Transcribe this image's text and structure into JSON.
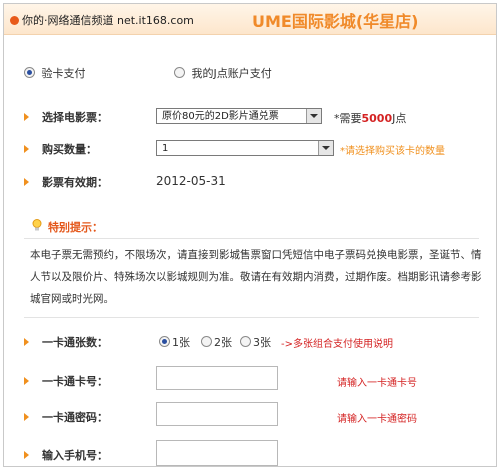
{
  "header": {
    "watermark_text": "你的·网络通信频道 net.it168.com",
    "title": "UME国际影城",
    "title_suffix": "(华星店)"
  },
  "payment": {
    "option1": "验卡支付",
    "option2": "我的J点账户支付",
    "selected": 1
  },
  "form": {
    "movie_label": "选择电影票：",
    "movie_value": "原价80元的2D影片通兑票",
    "movie_note_prefix": "*需要",
    "movie_note_amount": "5000",
    "movie_note_suffix": "J点",
    "qty_label": "购买数量：",
    "qty_value": "1",
    "qty_note": "*请选择购买该卡的数量",
    "valid_label": "影票有效期：",
    "valid_value": "2012-05-31"
  },
  "tips": {
    "heading": "特别提示：",
    "body": "本电子票无需预约，不限场次，请直接到影城售票窗口凭短信中电子票码兑换电影票，圣诞节、情人节以及限价片、特殊场次以影城规则为准。敬请在有效期内消费，过期作废。档期影讯请参考影城官网或时光网。"
  },
  "card": {
    "count_label": "一卡通张数：",
    "count_options": [
      "1张",
      "2张",
      "3张"
    ],
    "count_selected": 0,
    "count_link": "->多张组合支付使用说明",
    "number_label": "一卡通卡号：",
    "number_hint": "请输入一卡通卡号",
    "password_label": "一卡通密码：",
    "password_hint": "请输入一卡通密码",
    "phone_label": "输入手机号："
  },
  "colors": {
    "accent_orange": "#f0901e",
    "note_red": "#d42222",
    "radio_blue": "#2a4fa0"
  }
}
